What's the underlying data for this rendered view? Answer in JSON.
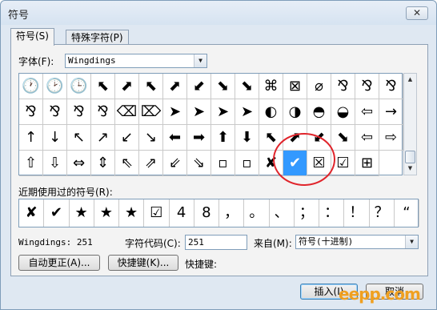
{
  "window": {
    "title": "符号",
    "close_glyph": "✕"
  },
  "tabs": [
    {
      "label": "符号(S)"
    },
    {
      "label": "特殊字符(P)"
    }
  ],
  "font": {
    "label": "字体(F):",
    "value": "Wingdings"
  },
  "symbol_grid": {
    "selected_index": 59,
    "cells": [
      "🕐",
      "🕑",
      "🕒",
      "⬉",
      "⬈",
      "⬉",
      "⬈",
      "⬋",
      "⬊",
      "⬊",
      "⌘",
      "⊠",
      "⌀",
      "⅋",
      "⅋",
      "⅋",
      "⅋",
      "⅋",
      "⅋",
      "⅋",
      "⌫",
      "⌦",
      "➤",
      "➤",
      "➤",
      "➤",
      "◐",
      "◑",
      "◓",
      "◒",
      "⇦",
      "→",
      "↑",
      "↓",
      "↖",
      "↗",
      "↙",
      "↘",
      "⬅",
      "➡",
      "⬆",
      "⬇",
      "⬉",
      "⬈",
      "⬋",
      "⬊",
      "⇦",
      "⇨",
      "⇧",
      "⇩",
      "⇔",
      "⇕",
      "⇖",
      "⇗",
      "⇙",
      "⇘",
      "▫",
      "▫",
      "✘",
      "✔",
      "☒",
      "☑",
      "⊞"
    ]
  },
  "recent": {
    "label": "近期使用过的符号(R):",
    "cells": [
      "✘",
      "✔",
      "★",
      "★",
      "★",
      "☑",
      "4",
      "8",
      "，",
      "。",
      "、",
      "；",
      "：",
      "！",
      "？",
      "“"
    ]
  },
  "info": {
    "font_code": "Wingdings: 251",
    "char_code_label": "字符代码(C):",
    "char_code_value": "251",
    "from_label": "来自(M):",
    "from_value": "符号(十进制)"
  },
  "buttons": {
    "autocorrect": "自动更正(A)...",
    "shortcut_key": "快捷键(K)...",
    "shortcut_label": "快捷键:",
    "insert": "插入(I)",
    "cancel": "取消"
  },
  "watermark": "eepp.com",
  "colors": {
    "selected": "#3399ff",
    "highlight_circle": "#e0242b"
  }
}
